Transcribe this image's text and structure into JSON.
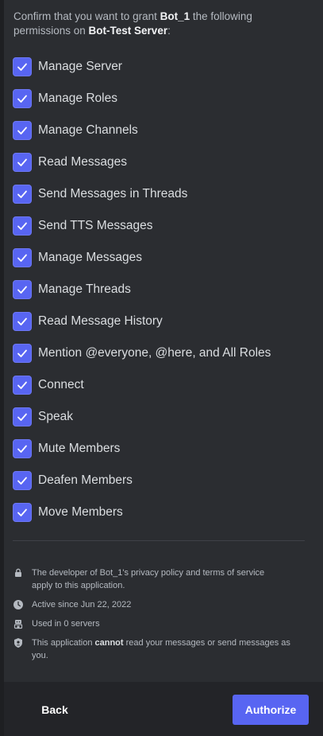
{
  "intro": {
    "prefix": "Confirm that you want to grant ",
    "bot_name": "Bot_1",
    "middle": " the following",
    "line2_prefix": "permissions on ",
    "server_name": "Bot-Test Server",
    "suffix": ":"
  },
  "permissions": [
    {
      "label": "Manage Server",
      "checked": true
    },
    {
      "label": "Manage Roles",
      "checked": true
    },
    {
      "label": "Manage Channels",
      "checked": true
    },
    {
      "label": "Read Messages",
      "checked": true
    },
    {
      "label": "Send Messages in Threads",
      "checked": true
    },
    {
      "label": "Send TTS Messages",
      "checked": true
    },
    {
      "label": "Manage Messages",
      "checked": true
    },
    {
      "label": "Manage Threads",
      "checked": true
    },
    {
      "label": "Read Message History",
      "checked": true
    },
    {
      "label": "Mention @everyone, @here, and All Roles",
      "checked": true
    },
    {
      "label": "Connect",
      "checked": true
    },
    {
      "label": "Speak",
      "checked": true
    },
    {
      "label": "Mute Members",
      "checked": true
    },
    {
      "label": "Deafen Members",
      "checked": true
    },
    {
      "label": "Move Members",
      "checked": true
    }
  ],
  "info": {
    "privacy": {
      "icon": "lock-icon",
      "line1": "The developer of Bot_1's privacy policy and terms of service",
      "line2": "apply to this application."
    },
    "active": {
      "icon": "clock-icon",
      "text": "Active since Jun 22, 2022"
    },
    "used": {
      "icon": "robot-icon",
      "text": "Used in 0 servers"
    },
    "security": {
      "icon": "shield-icon",
      "prefix": "This application ",
      "emphasis": "cannot",
      "suffix": " read your messages or send messages as",
      "line2": "you."
    }
  },
  "footer": {
    "back_label": "Back",
    "authorize_label": "Authorize"
  },
  "colors": {
    "accent": "#5865f2",
    "background": "#2b2d31",
    "footer": "#232428"
  }
}
